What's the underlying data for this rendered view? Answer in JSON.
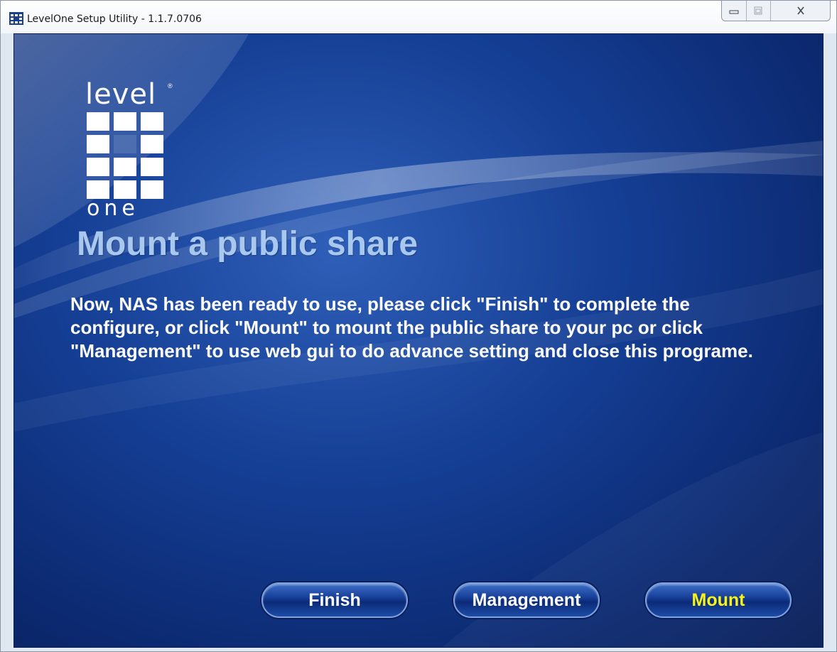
{
  "window": {
    "title": "LevelOne Setup Utility - 1.1.7.0706",
    "app_icon": "levelone-app-icon",
    "controls": {
      "minimize": "minimize-icon",
      "maximize": "maximize-icon",
      "close": "close-icon"
    }
  },
  "logo": {
    "top_text": "level",
    "registered": "®",
    "bottom_text": "one"
  },
  "heading": "Mount a public share",
  "message": "Now, NAS has been ready to use, please click \"Finish\" to complete the configure, or click \"Mount\" to mount the public share to your pc or click \"Management\" to use web gui to do advance setting and close this programe.",
  "buttons": {
    "finish": "Finish",
    "management": "Management",
    "mount": "Mount"
  },
  "colors": {
    "heading": "#a8c8ee",
    "mount_label": "#f7f21a",
    "background": "#153f95"
  }
}
